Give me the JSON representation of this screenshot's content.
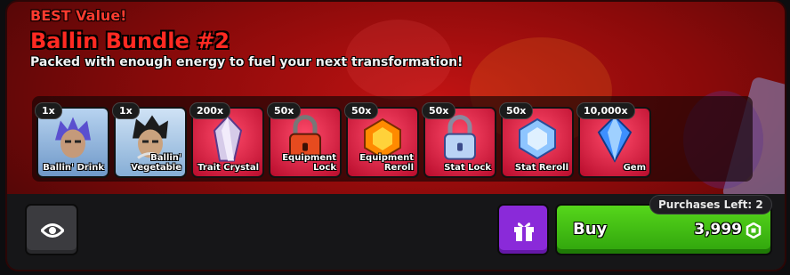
{
  "bundle": {
    "badge": "BEST Value!",
    "title": "Ballin Bundle #2",
    "description": "Packed with enough energy to fuel your next transformation!"
  },
  "items": [
    {
      "qty": "1x",
      "label": "Ballin' Drink",
      "icon": "character-portrait-icon",
      "bg": "#8fb6e0"
    },
    {
      "qty": "1x",
      "label": "Ballin' Vegetable",
      "icon": "character-portrait-icon",
      "bg": "#a8c8e6"
    },
    {
      "qty": "200x",
      "label": "Trait Crystal",
      "icon": "crystal-icon",
      "bg": "#d0143a"
    },
    {
      "qty": "50x",
      "label": "Equipment Lock",
      "icon": "padlock-icon",
      "bg": "#d0143a"
    },
    {
      "qty": "50x",
      "label": "Equipment Reroll",
      "icon": "gem-orange-icon",
      "bg": "#d0143a"
    },
    {
      "qty": "50x",
      "label": "Stat Lock",
      "icon": "padlock-icon",
      "bg": "#d0143a"
    },
    {
      "qty": "50x",
      "label": "Stat Reroll",
      "icon": "gem-blue-icon",
      "bg": "#d0143a"
    },
    {
      "qty": "10,000x",
      "label": "Gem",
      "icon": "gem-blue-icon",
      "bg": "#d0143a"
    }
  ],
  "footer": {
    "purchases_left": "Purchases Left: 2",
    "buy_label": "Buy",
    "price": "3,999",
    "currency_icon": "robux-icon",
    "preview_icon": "eye-icon",
    "gift_icon": "gift-icon"
  },
  "colors": {
    "accent_red": "#ff2a22",
    "buy_green": "#3fbf12",
    "gift_purple": "#8a2ad9"
  }
}
